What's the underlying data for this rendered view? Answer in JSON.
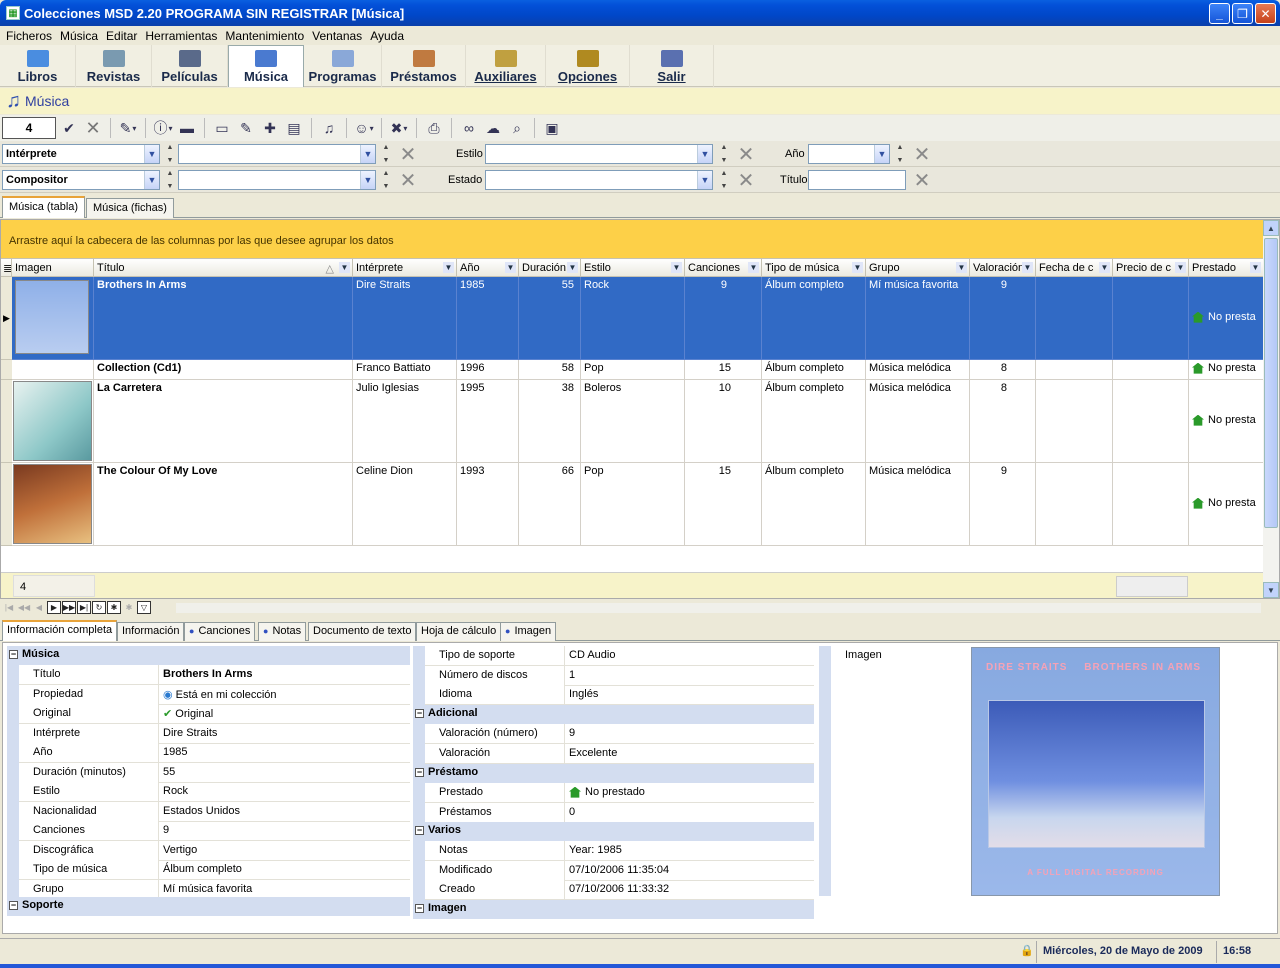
{
  "window": {
    "title": "Colecciones MSD 2.20 PROGRAMA SIN REGISTRAR [Música]"
  },
  "menu": [
    "Ficheros",
    "Música",
    "Editar",
    "Herramientas",
    "Mantenimiento",
    "Ventanas",
    "Ayuda"
  ],
  "nav": [
    {
      "label": "Libros",
      "color": "#4a8de0"
    },
    {
      "label": "Revistas",
      "color": "#7a9ab0"
    },
    {
      "label": "Películas",
      "color": "#5a6a8a"
    },
    {
      "label": "Música",
      "color": "#4a7ad0"
    },
    {
      "label": "Programas",
      "color": "#8aa8d8"
    },
    {
      "label": "Préstamos",
      "color": "#c07a40"
    },
    {
      "label": "Auxiliares",
      "color": "#c0a040"
    },
    {
      "label": "Opciones",
      "color": "#b08a20"
    },
    {
      "label": "Salir",
      "color": "#5a70b0"
    }
  ],
  "section": {
    "title": "Música"
  },
  "toolbar": {
    "count": "4"
  },
  "filters": {
    "row1": {
      "field1": "Intérprete",
      "label2": "Estilo",
      "label3": "Año"
    },
    "row2": {
      "field1": "Compositor",
      "label2": "Estado",
      "label3": "Título"
    }
  },
  "view_tabs": [
    "Música (tabla)",
    "Música (fichas)"
  ],
  "grid": {
    "group_hint": "Arrastre aquí la cabecera de las columnas por las que desee agrupar los datos",
    "columns": [
      "Imagen",
      "Título",
      "Intérprete",
      "Año",
      "Duración",
      "Estilo",
      "Canciones",
      "Tipo de música",
      "Grupo",
      "Valoración",
      "Fecha de c",
      "Precio de c",
      "Prestado"
    ],
    "rows": [
      {
        "titulo": "Brothers In Arms",
        "interprete": "Dire Straits",
        "anio": "1985",
        "duracion": "55",
        "estilo": "Rock",
        "canciones": "9",
        "tipo": "Álbum completo",
        "grupo": "Mí música favorita",
        "valoracion": "9",
        "prestado": "No presta"
      },
      {
        "titulo": "Collection (Cd1)",
        "interprete": "Franco Battiato",
        "anio": "1996",
        "duracion": "58",
        "estilo": "Pop",
        "canciones": "15",
        "tipo": "Álbum completo",
        "grupo": "Música melódica",
        "valoracion": "8",
        "prestado": "No presta"
      },
      {
        "titulo": "La Carretera",
        "interprete": "Julio Iglesias",
        "anio": "1995",
        "duracion": "38",
        "estilo": "Boleros",
        "canciones": "10",
        "tipo": "Álbum completo",
        "grupo": "Música melódica",
        "valoracion": "8",
        "prestado": "No presta"
      },
      {
        "titulo": "The Colour Of My Love",
        "interprete": "Celine Dion",
        "anio": "1993",
        "duracion": "66",
        "estilo": "Pop",
        "canciones": "15",
        "tipo": "Álbum completo",
        "grupo": "Música melódica",
        "valoracion": "9",
        "prestado": "No presta"
      }
    ],
    "footer_count": "4"
  },
  "detail_tabs": [
    "Información completa",
    "Información",
    "Canciones",
    "Notas",
    "Documento de texto",
    "Hoja de cálculo",
    "Imagen"
  ],
  "detail": {
    "cat_musica": "Música",
    "left": [
      {
        "k": "Título",
        "v": "Brothers In Arms"
      },
      {
        "k": "Propiedad",
        "v": "Está en mi colección"
      },
      {
        "k": "Original",
        "v": "Original"
      },
      {
        "k": "Intérprete",
        "v": "Dire Straits"
      },
      {
        "k": "Año",
        "v": "1985"
      },
      {
        "k": "Duración (minutos)",
        "v": "55"
      },
      {
        "k": "Estilo",
        "v": "Rock"
      },
      {
        "k": "Nacionalidad",
        "v": "Estados Unidos"
      },
      {
        "k": "Canciones",
        "v": "9"
      },
      {
        "k": "Discográfica",
        "v": "Vertigo"
      },
      {
        "k": "Tipo de música",
        "v": "Álbum completo"
      },
      {
        "k": "Grupo",
        "v": "Mí música favorita"
      }
    ],
    "cat_soporte": "Soporte",
    "mid_top": [
      {
        "k": "Tipo de soporte",
        "v": "CD Audio"
      },
      {
        "k": "Número de discos",
        "v": "1"
      },
      {
        "k": "Idioma",
        "v": "Inglés"
      }
    ],
    "cat_adicional": "Adicional",
    "mid_adicional": [
      {
        "k": "Valoración (número)",
        "v": "9"
      },
      {
        "k": "Valoración",
        "v": "Excelente"
      }
    ],
    "cat_prestamo": "Préstamo",
    "mid_prestamo": [
      {
        "k": "Prestado",
        "v": "No prestado"
      },
      {
        "k": "Préstamos",
        "v": "0"
      }
    ],
    "cat_varios": "Varios",
    "mid_varios": [
      {
        "k": "Notas",
        "v": "Year: 1985"
      },
      {
        "k": "Modificado",
        "v": "07/10/2006 11:35:04"
      },
      {
        "k": "Creado",
        "v": "07/10/2006 11:33:32"
      }
    ],
    "cat_imagen": "Imagen",
    "image_label": "Imagen",
    "cover": {
      "artist": "DIRE STRAITS",
      "album": "BROTHERS IN ARMS",
      "note": "A FULL DIGITAL RECORDING"
    }
  },
  "status": {
    "date": "Miércoles, 20 de Mayo de 2009",
    "time": "16:58"
  }
}
